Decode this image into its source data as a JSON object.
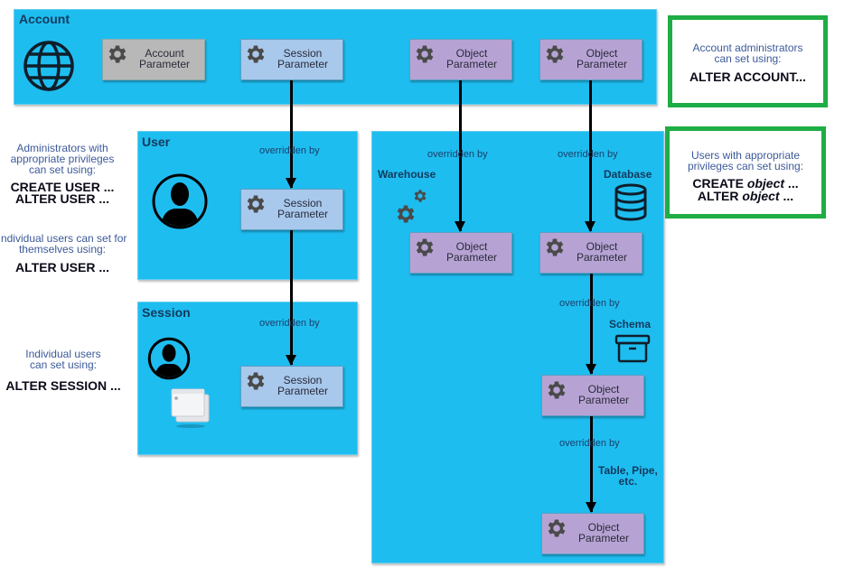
{
  "panels": {
    "account": {
      "title": "Account",
      "icon": "globe-icon"
    },
    "user": {
      "title": "User",
      "icon": "user-silhouette-icon"
    },
    "session": {
      "title": "Session",
      "icon": "user-silhouette-icon"
    },
    "objects": {
      "title": ""
    }
  },
  "params": {
    "account_param": {
      "line1": "Account",
      "line2": "Parameter"
    },
    "session_param": {
      "line1": "Session",
      "line2": "Parameter"
    },
    "object_param": {
      "line1": "Object",
      "line2": "Parameter"
    }
  },
  "overridden_by": "overridden by",
  "object_types": {
    "warehouse": "Warehouse",
    "database": "Database",
    "schema": "Schema",
    "table_pipe_line1": "Table, Pipe,",
    "table_pipe_line2": "etc."
  },
  "notes": {
    "account_admins": {
      "line1": "Account administrators",
      "line2": "can set using:",
      "cmd1": "ALTER ACCOUNT..."
    },
    "users_privileges": {
      "line1": "Users with appropriate",
      "line2": "privileges can set using:",
      "cmd1a": "CREATE ",
      "cmd1b": "object",
      "cmd1c": " ...",
      "cmd2a": "ALTER ",
      "cmd2b": "object",
      "cmd2c": " ..."
    },
    "user_admins": {
      "line1": "Administrators with",
      "line2": "appropriate privileges",
      "line3": "can set using:",
      "cmd1": "CREATE USER ...",
      "cmd2": "ALTER USER ..."
    },
    "user_self": {
      "line1": "Individual users can set for",
      "line2": "themselves using:",
      "cmd1": "ALTER USER ..."
    },
    "session_self": {
      "line1": "Individual users",
      "line2": "can set using:",
      "cmd1": "ALTER SESSION ..."
    }
  },
  "colors": {
    "panel_blue": "#1ebdf0",
    "account_param": "#b8b8b8",
    "session_param": "#a8c8ec",
    "object_param": "#b6a3d4",
    "green_border": "#1fad45"
  }
}
